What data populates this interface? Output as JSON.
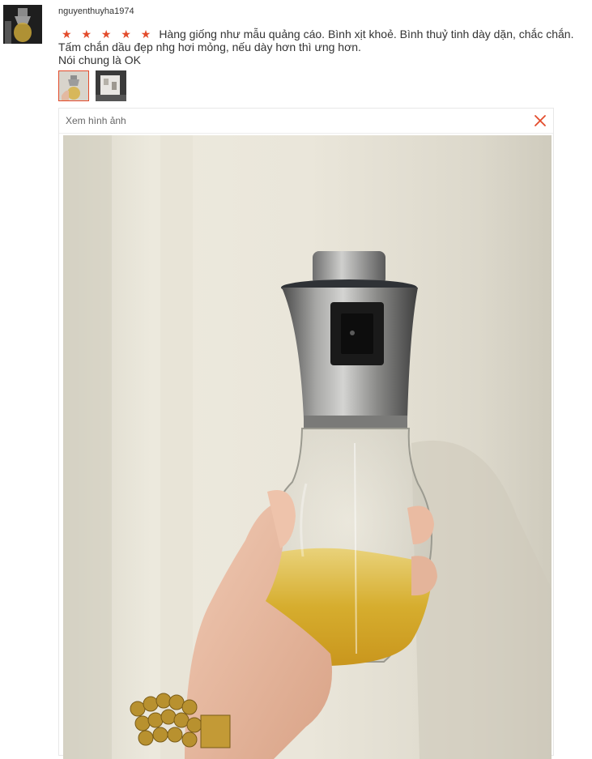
{
  "review": {
    "username": "nguyenthuyha1974",
    "stars_display": "★ ★ ★ ★ ★",
    "rating": 5,
    "comment_line1": "Hàng giống như mẫu quảng cáo. Bình xịt khoẻ. Bình thuỷ tinh dày dặn, chắc chắn.",
    "comment_line2": "Tấm chắn dầu đẹp nhg hơi mỏng, nếu dày hơn thì ưng hơn.",
    "comment_line3": "Nói chung là OK",
    "star_color": "#e34b2b"
  },
  "viewer": {
    "title": "Xem hình ảnh",
    "close_icon": "close-icon",
    "accent": "#e34b2b"
  }
}
